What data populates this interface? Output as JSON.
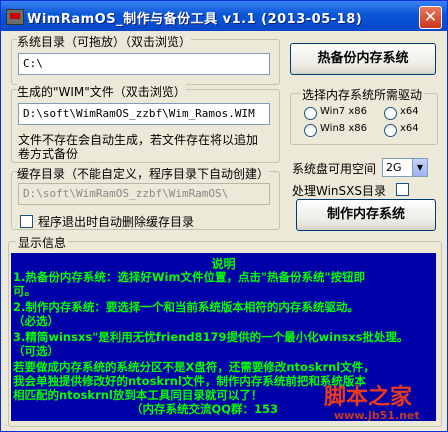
{
  "window": {
    "title": "WimRamOS_制作与备份工具 v1.1 (2013-05-18)",
    "close_glyph": "✕"
  },
  "left": {
    "sys_dir": {
      "label": "系统目录（可拖放）（双击浏览）",
      "value": "C:\\"
    },
    "wim_file": {
      "label": "生成的\"WIM\"文件（双击浏览）",
      "value": "D:\\soft\\WimRamOS_zzbf\\Wim_Ramos.WIM",
      "note_line1": "文件不存在会自动生成，若文件存在将以追加",
      "note_line2": "卷方式备份"
    },
    "cache_dir": {
      "label": "缓存目录（不能自定义，程序目录下自动创建）",
      "value": "D:\\soft\\WimRamOS_zzbf\\WimRamOS\\",
      "delete_label": "程序退出时自动删除缓存目录"
    }
  },
  "right": {
    "hot_backup_button": "热备份内存系统",
    "driver_group": {
      "label": "选择内存系统所需驱动",
      "options": [
        "Win7 x86",
        "x64",
        "Win8 x86",
        "x64"
      ]
    },
    "free_space_label": "系统盘可用空间",
    "free_space_value": "2G",
    "winsxs_label": "处理WinSXS目录",
    "make_button": "制作内存系统"
  },
  "info": {
    "label": "显示信息",
    "title": "说明",
    "lines": [
      "1.热备份内存系统：选择好Wim文件位置，点击\"热备份系统\"按钮即",
      "可。",
      "2.制作内存系统：要选择一个和当前系统版本相符的内存系统驱动。",
      "（必选）",
      "3.精简winsxs\"是利用无忧friend8179提供的一个最小化winsxs批处理。",
      "（可选）",
      "若要做成内存系统的系统分区不是X盘符，还需要修改ntoskrnl文件，",
      "我会单独提供修改好的ntoskrnl文件，制作内存系统前把和系统版本",
      "相匹配的ntoskrnl放到本工具同目录就可以了！",
      "（内存系统交流QQ群：153"
    ]
  },
  "watermark": {
    "text": "脚本之家",
    "url": "www.jb51.net"
  }
}
